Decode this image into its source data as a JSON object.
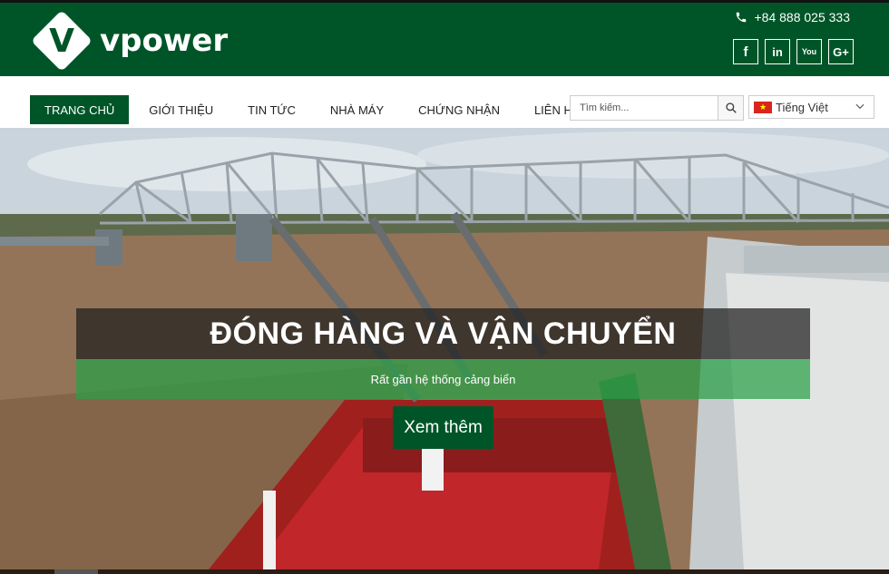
{
  "header": {
    "logo_letter": "V",
    "logo_text": "vpower",
    "phone": "+84 888 025 333",
    "socials": [
      {
        "name": "facebook",
        "glyph": "f"
      },
      {
        "name": "linkedin",
        "glyph": "in"
      },
      {
        "name": "youtube",
        "glyph": "You"
      },
      {
        "name": "google-plus",
        "glyph": "G+"
      }
    ]
  },
  "nav": {
    "items": [
      "TRANG CHỦ",
      "GIỚI THIỆU",
      "TIN TỨC",
      "NHÀ MÁY",
      "CHỨNG NHẬN",
      "LIÊN HỆ"
    ],
    "active_index": 0,
    "search_placeholder": "Tìm kiếm...",
    "language": "Tiếng Việt"
  },
  "hero": {
    "title": "ĐÓNG HÀNG VÀ VẬN CHUYỂN",
    "subtitle": "Rất gần hệ thống cảng biển",
    "button": "Xem thêm"
  },
  "colors": {
    "brand_green": "#005528",
    "subtitle_green": "#28a046"
  }
}
